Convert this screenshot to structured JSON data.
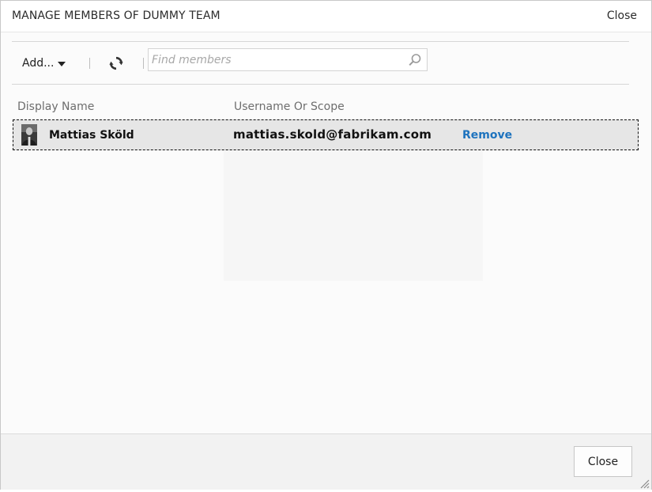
{
  "dialog": {
    "title": "MANAGE MEMBERS OF DUMMY TEAM",
    "title_close_label": "Close"
  },
  "toolbar": {
    "add_label": "Add...",
    "refresh_icon": "refresh-icon",
    "search": {
      "placeholder": "Find members",
      "value": "",
      "icon": "search-icon"
    }
  },
  "table": {
    "columns": [
      "Display Name",
      "Username Or Scope"
    ],
    "rows": [
      {
        "display_name": "Mattias Sköld",
        "username": "mattias.skold@fabrikam.com",
        "action_label": "Remove",
        "avatar": "user-photo"
      }
    ]
  },
  "footer": {
    "close_label": "Close"
  },
  "colors": {
    "link": "#1e73be",
    "selected_row": "#e6e6e6",
    "footer_bg": "#f2f2f2"
  }
}
